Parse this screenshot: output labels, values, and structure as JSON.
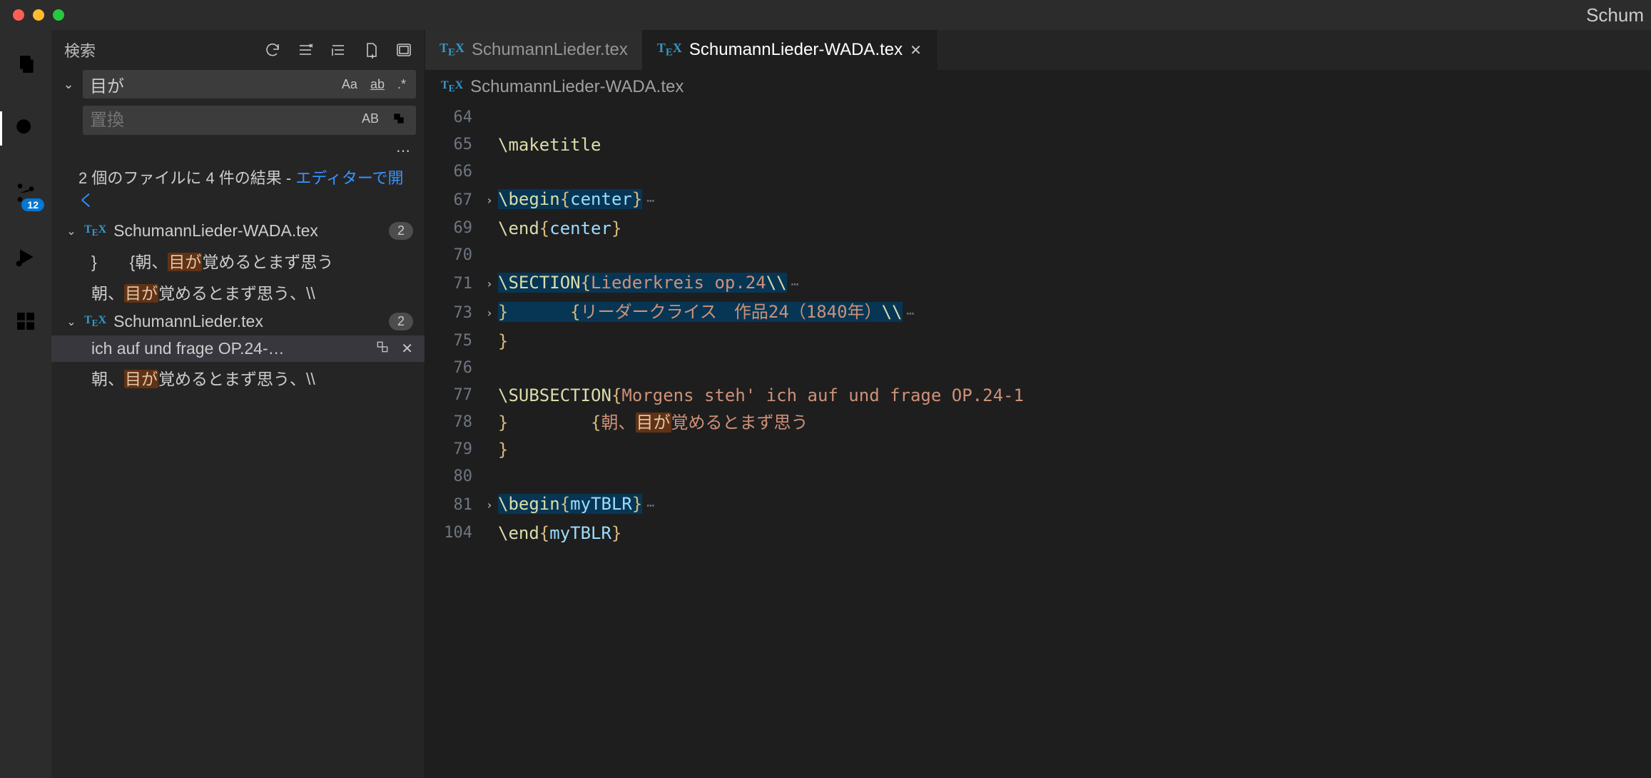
{
  "window": {
    "title": "Schum"
  },
  "activitybar": {
    "items": [
      "explorer",
      "search",
      "scm",
      "debug",
      "extensions"
    ],
    "active": "search",
    "scm_badge": "12"
  },
  "search": {
    "header": "検索",
    "input_value": "目が",
    "case_label": "Aa",
    "word_label": "ab",
    "regex_label": ".*",
    "replace_placeholder": "置換",
    "preserve_label": "AB",
    "summary_text": "2 個のファイルに 4 件の結果 - ",
    "summary_link": "エディターで開く",
    "files": [
      {
        "name": "SchumannLieder-WADA.tex",
        "count": "2",
        "lines": [
          {
            "pre": "}　　{朝、",
            "match": "目が",
            "post": "覚めるとまず思う"
          },
          {
            "pre": "朝、",
            "match": "目が",
            "post": "覚めるとまず思う、\\\\"
          }
        ]
      },
      {
        "name": "SchumannLieder.tex",
        "count": "2",
        "lines": [
          {
            "pre": "ich auf und frage OP.24-…",
            "match": "",
            "post": "",
            "hover": true
          },
          {
            "pre": "朝、",
            "match": "目が",
            "post": "覚めるとまず思う、\\\\"
          }
        ]
      }
    ]
  },
  "tabs": [
    {
      "label": "SchumannLieder.tex",
      "active": false
    },
    {
      "label": "SchumannLieder-WADA.tex",
      "active": true
    }
  ],
  "breadcrumb": "SchumannLieder-WADA.tex",
  "code": [
    {
      "n": "64",
      "fold": "",
      "raw": ""
    },
    {
      "n": "65",
      "fold": "",
      "cmd": "\\maketitle",
      "rest": ""
    },
    {
      "n": "66",
      "fold": "",
      "raw": ""
    },
    {
      "n": "67",
      "fold": ">",
      "hl": true,
      "cmd": "\\begin",
      "brace_arg": "center",
      "ell": true
    },
    {
      "n": "69",
      "fold": "",
      "cmd": "\\end",
      "brace_arg": "center"
    },
    {
      "n": "70",
      "fold": "",
      "raw": ""
    },
    {
      "n": "71",
      "fold": ">",
      "hl": true,
      "cmd": "\\SECTION",
      "brace_open": true,
      "str": "Liederkreis op.24",
      "tail_cmd": "\\\\",
      "ell": true
    },
    {
      "n": "73",
      "fold": ">",
      "hl": true,
      "brace_close_lead": "}",
      "gap": "      ",
      "brace_open2": "{",
      "str2": "リーダークライス　作品24（1840年）",
      "tail_cmd2": "\\\\",
      "ell": true
    },
    {
      "n": "75",
      "fold": "",
      "brace_only": "}"
    },
    {
      "n": "76",
      "fold": "",
      "raw": ""
    },
    {
      "n": "77",
      "fold": "",
      "cmd": "\\SUBSECTION",
      "brace_open": true,
      "str": "Morgens steh' ich auf und frage OP.24-1"
    },
    {
      "n": "78",
      "fold": "",
      "hl_match": true,
      "brace_close_lead": "}",
      "gap": "        ",
      "brace_open2": "{",
      "pre_plain": "朝、",
      "match": "目が",
      "post_plain": "覚めるとまず思う"
    },
    {
      "n": "79",
      "fold": "",
      "brace_only": "}"
    },
    {
      "n": "80",
      "fold": "",
      "raw": ""
    },
    {
      "n": "81",
      "fold": ">",
      "hl": true,
      "cmd": "\\begin",
      "brace_arg": "myTBLR",
      "ell": true
    },
    {
      "n": "104",
      "fold": "",
      "cmd": "\\end",
      "brace_arg": "myTBLR"
    }
  ]
}
